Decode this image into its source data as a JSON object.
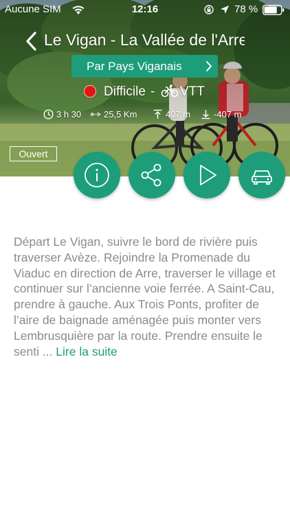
{
  "status_bar": {
    "carrier": "Aucune SIM",
    "time": "12:16",
    "battery_percent": "78 %",
    "battery_level": 0.78
  },
  "header": {
    "title": "Le Vigan - La Vallée de l'Arre",
    "author_button_label": "Par  Pays Viganais"
  },
  "trek": {
    "difficulty": "Difficile",
    "difficulty_color": "#e21515",
    "activity_separator": "-",
    "activity": "VTT",
    "duration": "3 h 30",
    "distance": "25,5 Km",
    "ascent": "407 m",
    "descent": "-407 m",
    "status": "Ouvert"
  },
  "actions": [
    {
      "name": "info",
      "icon": "info-icon"
    },
    {
      "name": "share",
      "icon": "share-icon"
    },
    {
      "name": "play",
      "icon": "play-icon"
    },
    {
      "name": "car",
      "icon": "car-icon"
    }
  ],
  "description": {
    "text": "Départ Le Vigan, suivre le bord de rivière puis traverser Avèze. Rejoindre la Promenade du Viaduc en direction de Arre, traverser le village et continuer sur l’ancienne voie ferrée. A Saint-Cau, prendre à gauche. Aux Trois Ponts, profiter de l’aire de baignade aménagée puis monter vers Lembrusquière par la route. Prendre ensuite le senti ...",
    "read_more": "Lire la suite"
  },
  "colors": {
    "accent": "#1d9d7a",
    "description_text": "#8a8a8a"
  }
}
